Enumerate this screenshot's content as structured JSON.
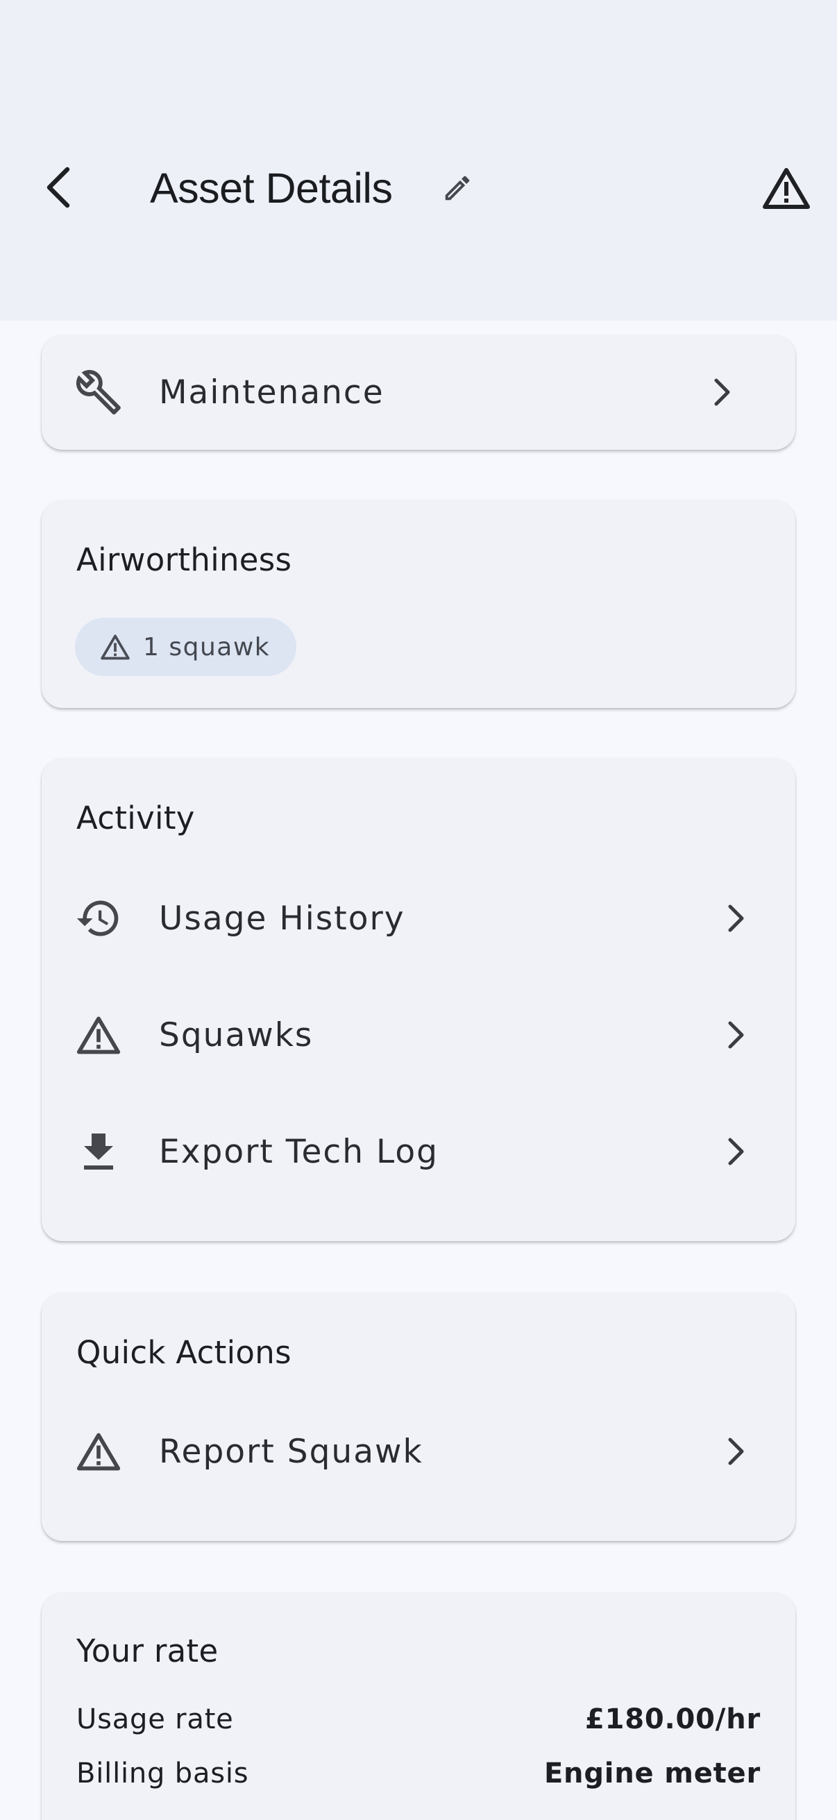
{
  "header": {
    "title": "Asset Details",
    "icons": {
      "back": "chevron-left-icon",
      "edit": "pencil-icon",
      "alert": "warning-triangle-icon"
    }
  },
  "maintenance_card": {
    "label": "Maintenance",
    "icon": "wrench-icon"
  },
  "airworthiness": {
    "title": "Airworthiness",
    "chip_label": "1 squawk",
    "chip_icon": "warning-triangle-icon"
  },
  "activity": {
    "title": "Activity",
    "items": [
      {
        "label": "Usage History",
        "icon": "history-icon"
      },
      {
        "label": "Squawks",
        "icon": "warning-triangle-icon"
      },
      {
        "label": "Export Tech Log",
        "icon": "download-icon"
      }
    ]
  },
  "quick_actions": {
    "title": "Quick Actions",
    "items": [
      {
        "label": "Report Squawk",
        "icon": "warning-triangle-icon"
      }
    ]
  },
  "rate": {
    "title": "Your rate",
    "rows": [
      {
        "label": "Usage rate",
        "value": "£180.00/hr"
      },
      {
        "label": "Billing basis",
        "value": "Engine meter"
      }
    ]
  },
  "colors": {
    "background": "#f7f8fe",
    "app_bar": "#eef0f8",
    "card": "#f1f2f8",
    "chip": "#dde5f3",
    "icon": "#45474d"
  }
}
